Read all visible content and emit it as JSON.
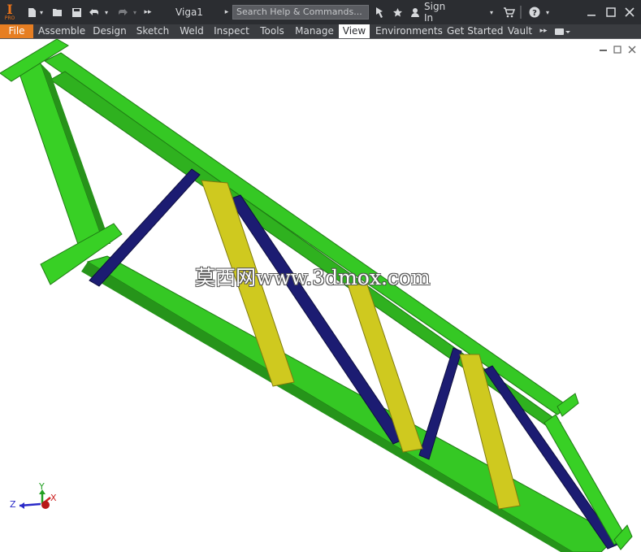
{
  "app": {
    "logo_glyph": "I",
    "logo_sub": "PRO",
    "document_title": "Viga1",
    "search_placeholder": "Search Help & Commands...",
    "sign_in_label": "Sign In",
    "help_label": "?"
  },
  "ribbon": {
    "tabs": [
      {
        "label": "File"
      },
      {
        "label": "Assemble"
      },
      {
        "label": "Design"
      },
      {
        "label": "Sketch"
      },
      {
        "label": "Weld"
      },
      {
        "label": "Inspect"
      },
      {
        "label": "Tools"
      },
      {
        "label": "Manage"
      },
      {
        "label": "View"
      },
      {
        "label": "Environments"
      },
      {
        "label": "Get Started"
      },
      {
        "label": "Vault"
      }
    ],
    "active_tab": "View"
  },
  "viewport": {
    "triad_labels": {
      "x": "X",
      "y": "Y",
      "z": "Z"
    },
    "watermark": "莫西网www.3dmox.com"
  },
  "colors": {
    "frame_green": "#33cc22",
    "brace_navy": "#1a1a6e",
    "brace_olive": "#c8c41c",
    "title_bar": "#2b2d31",
    "file_tab": "#e67e22"
  }
}
